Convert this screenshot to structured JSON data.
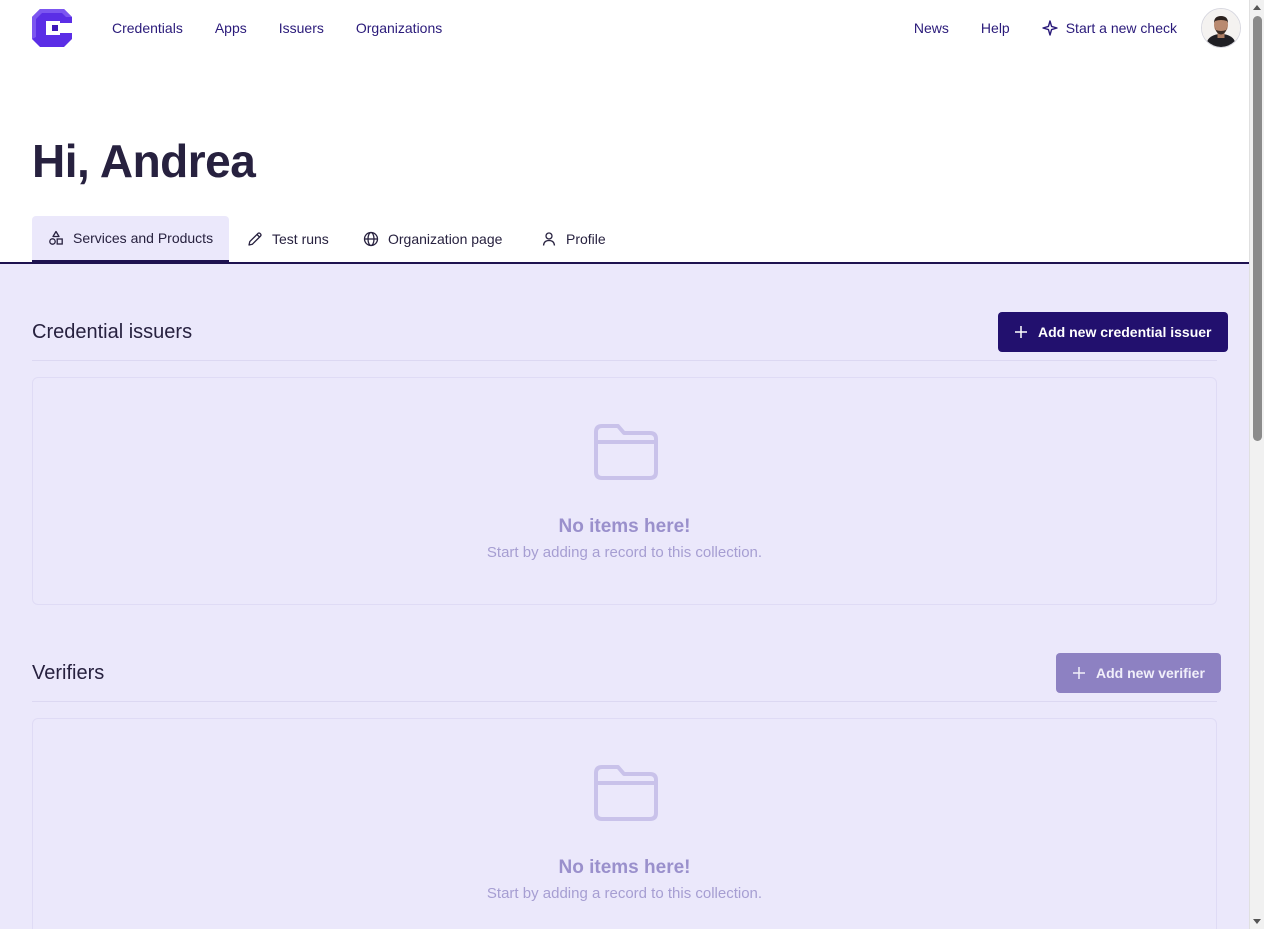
{
  "nav": {
    "links": [
      "Credentials",
      "Apps",
      "Issuers",
      "Organizations"
    ],
    "news": "News",
    "help": "Help",
    "start_check": "Start a new check"
  },
  "greeting": "Hi, Andrea",
  "tabs": [
    {
      "label": "Services and Products",
      "icon": "shapes-icon",
      "active": true
    },
    {
      "label": "Test runs",
      "icon": "pencil-icon",
      "active": false
    },
    {
      "label": "Organization page",
      "icon": "globe-icon",
      "active": false
    },
    {
      "label": "Profile",
      "icon": "user-icon",
      "active": false
    }
  ],
  "sections": {
    "issuers": {
      "title": "Credential issuers",
      "button": "Add new credential issuer",
      "empty_title": "No items here!",
      "empty_sub": "Start by adding a record to this collection."
    },
    "verifiers": {
      "title": "Verifiers",
      "button": "Add new verifier",
      "empty_title": "No items here!",
      "empty_sub": "Start by adding a record to this collection."
    }
  },
  "colors": {
    "brand": "#5b2ee6",
    "primary_button": "#22106e",
    "disabled_button": "#8d81c2",
    "content_bg": "#ebe8fb"
  }
}
